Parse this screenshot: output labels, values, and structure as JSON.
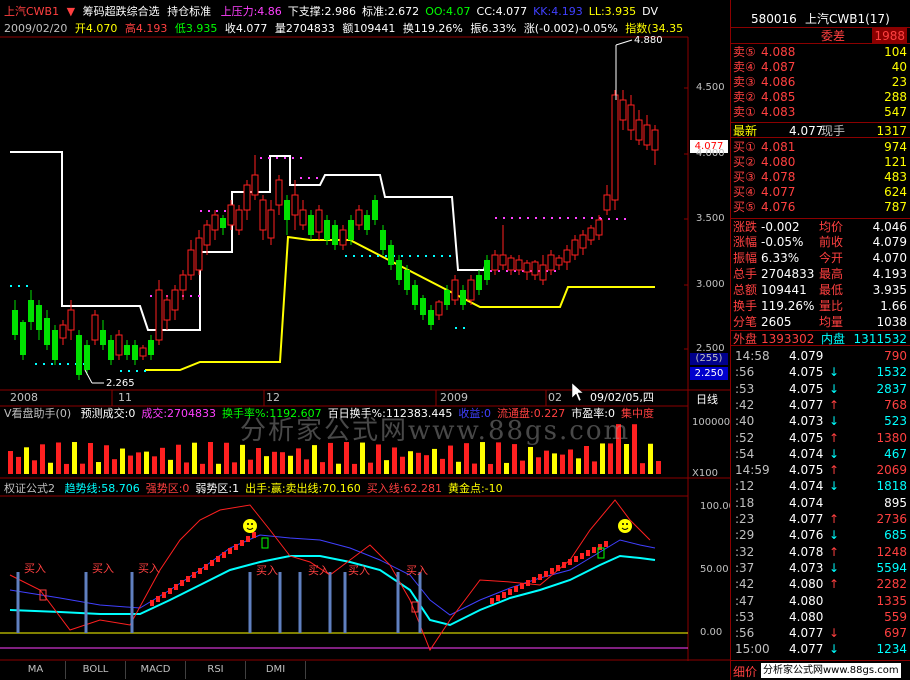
{
  "main_info": {
    "stock": "上汽CWB1",
    "indicator_name": "筹码超跌综合选",
    "sub_name": "持仓标准",
    "fields": [
      {
        "label": "上压力:4.86",
        "color": "#ff40ff"
      },
      {
        "label": "下支撑:2.986",
        "color": "#ffffff"
      },
      {
        "label": "标准:2.672",
        "color": "#ffffff"
      },
      {
        "label": "OO:4.07",
        "color": "#00ff00"
      },
      {
        "label": "CC:4.077",
        "color": "#ffffff"
      },
      {
        "label": "KK:4.193",
        "color": "#4040ff"
      },
      {
        "label": "LL:3.935",
        "color": "#ffff00"
      },
      {
        "label": "DV",
        "color": "#ffffff"
      }
    ]
  },
  "quote_line": {
    "date": "2009/02/20",
    "open": "开4.070",
    "high": "高4.193",
    "low": "低3.935",
    "close": "收4.077",
    "volume": "量2704833",
    "amount": "额109441",
    "turnover": "换119.26%",
    "amplitude": "振6.33%",
    "change": "涨(-0.002)-0.05%",
    "index": "指数(34.35"
  },
  "price_axis": [
    "4.500",
    "4.000",
    "3.500",
    "3.000",
    "2.500"
  ],
  "price_markers": {
    "high": "4.880",
    "low": "2.265",
    "current": "4.077",
    "box_top": "(255)",
    "box_value": "2.250"
  },
  "date_axis": [
    "2008",
    "11",
    "12",
    "2009",
    "02"
  ],
  "cursor_date": "09/02/05,四",
  "period_label": "日线",
  "volume_panel": {
    "title": "V看盘助手(0)",
    "items": [
      {
        "label": "预测成交:0",
        "color": "#ffffff"
      },
      {
        "label": "成交:2704833",
        "color": "#ff40ff"
      },
      {
        "label": "换手率%:1192.607",
        "color": "#00ff00"
      },
      {
        "label": "百日换手%:112383.445",
        "color": "#ffffff"
      },
      {
        "label": "收益:0",
        "color": "#4040ff"
      },
      {
        "label": "流通盘:0.227",
        "color": "#ff4040"
      },
      {
        "label": "市盈率:0",
        "color": "#ffffff"
      },
      {
        "label": "集中度",
        "color": "#ff4040"
      }
    ],
    "axis_top": "100000",
    "axis_bottom": "X100"
  },
  "watermark": "分析家公式网www.88gs.com",
  "indicator_panel": {
    "title": "权证公式2",
    "items": [
      {
        "label": "趋势线:58.706",
        "color": "#00ffff"
      },
      {
        "label": "强势区:0",
        "color": "#ff4040"
      },
      {
        "label": "弱势区:1",
        "color": "#ffffff"
      },
      {
        "label": "出手:赢:卖出线:70.160",
        "color": "#ffff00"
      },
      {
        "label": "买入线:62.281",
        "color": "#ff4040"
      },
      {
        "label": "黄金点:-10",
        "color": "#ffff00"
      }
    ],
    "axis": [
      "100.00",
      "50.00",
      "0.00"
    ],
    "buy_label": "买入"
  },
  "tabs": [
    "MA",
    "BOLL",
    "MACD",
    "RSI",
    "DMI"
  ],
  "right_panel": {
    "code": "580016",
    "name": "上汽CWB1(17)",
    "weibi_label": "委差",
    "weibi_value": "1988",
    "sells": [
      {
        "label": "卖⑤",
        "price": "4.088",
        "vol": "104"
      },
      {
        "label": "卖④",
        "price": "4.087",
        "vol": "40"
      },
      {
        "label": "卖③",
        "price": "4.086",
        "vol": "23"
      },
      {
        "label": "卖②",
        "price": "4.085",
        "vol": "288"
      },
      {
        "label": "卖①",
        "price": "4.083",
        "vol": "547"
      }
    ],
    "latest": {
      "label": "最新",
      "price": "4.077",
      "label2": "现手",
      "vol": "1317"
    },
    "buys": [
      {
        "label": "买①",
        "price": "4.081",
        "vol": "974"
      },
      {
        "label": "买②",
        "price": "4.080",
        "vol": "121"
      },
      {
        "label": "买③",
        "price": "4.078",
        "vol": "483"
      },
      {
        "label": "买④",
        "price": "4.077",
        "vol": "624"
      },
      {
        "label": "买⑤",
        "price": "4.076",
        "vol": "787"
      }
    ],
    "stats": [
      {
        "l1": "涨跌",
        "v1": "-0.002",
        "l2": "均价",
        "v2": "4.046"
      },
      {
        "l1": "涨幅",
        "v1": "-0.05%",
        "l2": "前收",
        "v2": "4.079"
      },
      {
        "l1": "振幅",
        "v1": "6.33%",
        "l2": "今开",
        "v2": "4.070"
      },
      {
        "l1": "总手",
        "v1": "2704833",
        "l2": "最高",
        "v2": "4.193"
      },
      {
        "l1": "总额",
        "v1": "109441",
        "l2": "最低",
        "v2": "3.935"
      },
      {
        "l1": "换手",
        "v1": "119.26%",
        "l2": "量比",
        "v2": "1.66"
      },
      {
        "l1": "分笔",
        "v1": "2605",
        "l2": "均量",
        "v2": "1038"
      }
    ],
    "waipan_label": "外盘",
    "waipan": "1393302",
    "neipan_label": "内盘",
    "neipan": "1311532",
    "ticks": [
      {
        "t": "14:58",
        "p": "4.079",
        "a": "",
        "v": "790",
        "c": "#ff4040"
      },
      {
        "t": ":56",
        "p": "4.075",
        "a": "↓",
        "v": "1532",
        "c": "#00ffff"
      },
      {
        "t": ":53",
        "p": "4.075",
        "a": "↓",
        "v": "2837",
        "c": "#00ffff"
      },
      {
        "t": ":42",
        "p": "4.077",
        "a": "↑",
        "v": "768",
        "c": "#ff4040"
      },
      {
        "t": ":40",
        "p": "4.073",
        "a": "↓",
        "v": "523",
        "c": "#00ffff"
      },
      {
        "t": ":52",
        "p": "4.075",
        "a": "↑",
        "v": "1380",
        "c": "#ff4040"
      },
      {
        "t": ":54",
        "p": "4.074",
        "a": "↓",
        "v": "467",
        "c": "#00ffff"
      },
      {
        "t": "14:59",
        "p": "4.075",
        "a": "↑",
        "v": "2069",
        "c": "#ff4040"
      },
      {
        "t": ":12",
        "p": "4.074",
        "a": "↓",
        "v": "1818",
        "c": "#00ffff"
      },
      {
        "t": ":18",
        "p": "4.074",
        "a": "",
        "v": "895",
        "c": "#ffffff"
      },
      {
        "t": ":23",
        "p": "4.077",
        "a": "↑",
        "v": "2736",
        "c": "#ff4040"
      },
      {
        "t": ":29",
        "p": "4.076",
        "a": "↓",
        "v": "685",
        "c": "#00ffff"
      },
      {
        "t": ":32",
        "p": "4.078",
        "a": "↑",
        "v": "1248",
        "c": "#ff4040"
      },
      {
        "t": ":37",
        "p": "4.073",
        "a": "↓",
        "v": "5594",
        "c": "#00ffff"
      },
      {
        "t": ":42",
        "p": "4.080",
        "a": "↑",
        "v": "2282",
        "c": "#ff4040"
      },
      {
        "t": ":47",
        "p": "4.080",
        "a": "",
        "v": "1335",
        "c": "#ff4040"
      },
      {
        "t": ":53",
        "p": "4.080",
        "a": "",
        "v": "559",
        "c": "#ff4040"
      },
      {
        "t": ":56",
        "p": "4.077",
        "a": "↓",
        "v": "697",
        "c": "#ff4040"
      },
      {
        "t": "15:00",
        "p": "4.077",
        "a": "↓",
        "v": "1234",
        "c": "#00ffff"
      }
    ],
    "footer": "细价",
    "footer_brand": "分析家公式网www.88gs.com"
  }
}
